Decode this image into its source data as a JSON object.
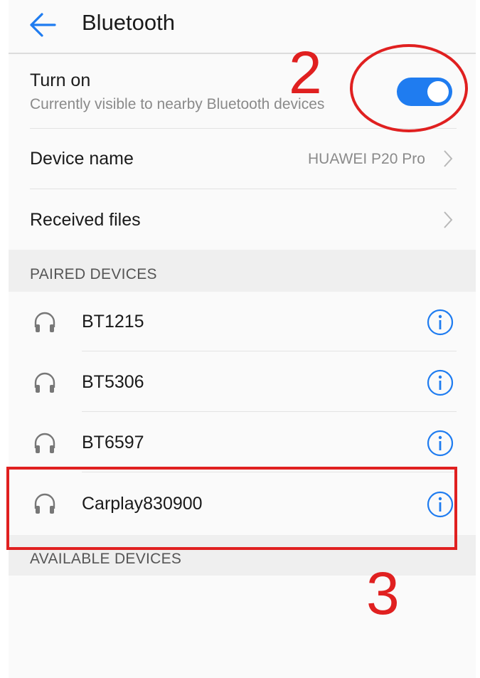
{
  "header": {
    "back_icon": "arrow-left-icon",
    "title": "Bluetooth"
  },
  "turn_on": {
    "label": "Turn on",
    "subtitle": "Currently visible to nearby Bluetooth devices",
    "enabled": true
  },
  "device_name": {
    "label": "Device name",
    "value": "HUAWEI P20 Pro"
  },
  "received_files": {
    "label": "Received files"
  },
  "paired": {
    "section_label": "PAIRED DEVICES",
    "devices": [
      {
        "name": "BT1215",
        "icon": "headset-icon"
      },
      {
        "name": "BT5306",
        "icon": "headset-icon"
      },
      {
        "name": "BT6597",
        "icon": "headset-icon"
      },
      {
        "name": "Carplay830900",
        "icon": "headset-icon"
      }
    ]
  },
  "available": {
    "section_label": "AVAILABLE DEVICES"
  },
  "annotations": {
    "toggle_step": "2",
    "device_step": "3",
    "color": "#e02020"
  },
  "colors": {
    "accent": "#1f7cf0"
  }
}
